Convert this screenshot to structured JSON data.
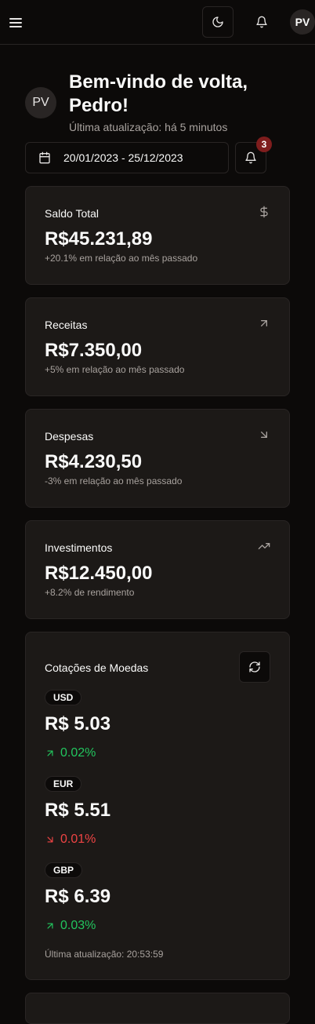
{
  "header": {
    "avatar_initials": "PV",
    "icons": [
      "menu-icon",
      "moon-icon",
      "bell-icon"
    ]
  },
  "welcome": {
    "avatar_initials": "PV",
    "title": "Bem-vindo de volta, Pedro!",
    "subtitle": "Última atualização: há 5 minutos"
  },
  "date_range": "20/01/2023 - 25/12/2023",
  "notifications": {
    "count": "3"
  },
  "cards": [
    {
      "title": "Saldo Total",
      "value": "R$45.231,89",
      "desc": "+20.1% em relação ao mês passado",
      "icon": "dollar-icon"
    },
    {
      "title": "Receitas",
      "value": "R$7.350,00",
      "desc": "+5% em relação ao mês passado",
      "icon": "arrow-up-right-icon"
    },
    {
      "title": "Despesas",
      "value": "R$4.230,50",
      "desc": "-3% em relação ao mês passado",
      "icon": "arrow-down-right-icon"
    },
    {
      "title": "Investimentos",
      "value": "R$12.450,00",
      "desc": "+8.2% de rendimento",
      "icon": "trending-up-icon"
    }
  ],
  "fx": {
    "title": "Cotações de Moedas",
    "currencies": [
      {
        "code": "USD",
        "value": "R$ 5.03",
        "change": "0.02%",
        "direction": "up"
      },
      {
        "code": "EUR",
        "value": "R$ 5.51",
        "change": "0.01%",
        "direction": "down"
      },
      {
        "code": "GBP",
        "value": "R$ 6.39",
        "change": "0.03%",
        "direction": "up"
      }
    ],
    "updated": "Última atualização: 20:53:59"
  },
  "colors": {
    "up": "#22c55e",
    "down": "#ef4444",
    "background": "#0c0a09",
    "card": "#1c1917",
    "border": "#292524"
  }
}
